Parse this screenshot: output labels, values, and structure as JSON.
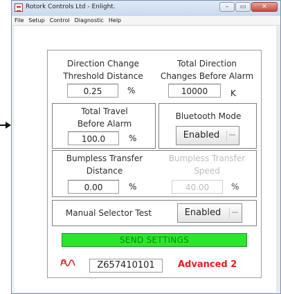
{
  "window": {
    "title": "Rotork Controls Ltd - Enlight.",
    "controls": {
      "minimize": "–",
      "maximize": "▭",
      "close": "✕"
    }
  },
  "menu": [
    "File",
    "Setup",
    "Control",
    "Diagnostic",
    "Help"
  ],
  "settings": {
    "direction_change": {
      "label_line1": "Direction Change",
      "label_line2": "Threshold Distance",
      "value": "0.25",
      "unit": "%"
    },
    "total_direction": {
      "label_line1": "Total Direction",
      "label_line2": "Changes Before Alarm",
      "value": "10000",
      "unit": "K"
    },
    "total_travel": {
      "label_line1": "Total Travel",
      "label_line2": "Before Alarm",
      "value": "100.0",
      "unit": "%"
    },
    "bluetooth": {
      "label": "Bluetooth Mode",
      "selected": "Enabled"
    },
    "bumpless_distance": {
      "label_line1": "Bumpless Transfer",
      "label_line2": "Distance",
      "value": "0.00",
      "unit": "%"
    },
    "bumpless_speed": {
      "label_line1": "Bumpless Transfer",
      "label_line2": "Speed",
      "value": "40.00",
      "unit": "%"
    },
    "manual_selector": {
      "label": "Manual Selector Test",
      "selected": "Enabled"
    }
  },
  "send_button": "SEND SETTINGS",
  "footer": {
    "icon": "signal-wave-icon",
    "serial": "Z657410101",
    "mode": "Advanced 2"
  },
  "colors": {
    "send_green": "#2ee52e",
    "mode_red": "#e11e1e"
  }
}
